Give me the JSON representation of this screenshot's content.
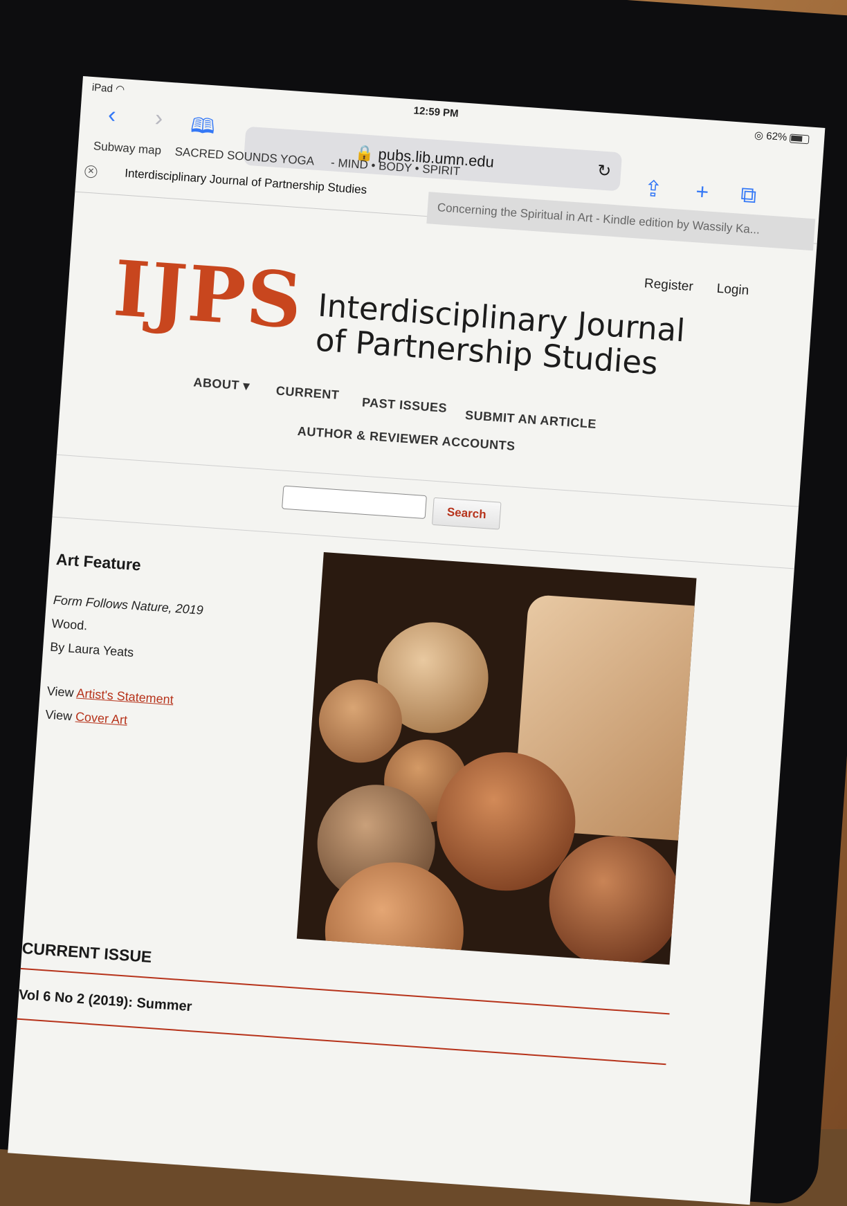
{
  "statusbar": {
    "device": "iPad",
    "time": "12:59 PM",
    "battery": "62%"
  },
  "toolbar": {
    "url": "pubs.lib.umn.edu",
    "favorites": [
      "Subway map",
      "SACRED SOUNDS YOGA",
      "-   MIND • BODY • SPIRIT"
    ]
  },
  "tabs": {
    "active": "Interdisciplinary Journal of Partnership Studies",
    "other": "Concerning the Spiritual in Art - Kindle edition by Wassily Ka..."
  },
  "site": {
    "logo": "IJPS",
    "title": "Interdisciplinary Journal of Partnership Studies",
    "auth": {
      "register": "Register",
      "login": "Login"
    },
    "nav": {
      "about": "ABOUT",
      "current": "CURRENT",
      "past": "PAST ISSUES",
      "submit": "SUBMIT AN ARTICLE",
      "accounts": "AUTHOR & REVIEWER ACCOUNTS"
    },
    "search": {
      "button": "Search",
      "placeholder": ""
    }
  },
  "art": {
    "heading": "Art Feature",
    "title": "Form Follows Nature, 2019",
    "medium": "Wood.",
    "author": "By Laura Yeats",
    "view_prefix": "View",
    "link_statement": "Artist's Statement",
    "link_cover": "Cover Art"
  },
  "current_issue": {
    "heading": "CURRENT ISSUE",
    "volume": "Vol 6 No 2 (2019): Summer"
  },
  "colors": {
    "brand": "#c8461e",
    "link": "#b6321a",
    "ios_blue": "#3478f6"
  }
}
